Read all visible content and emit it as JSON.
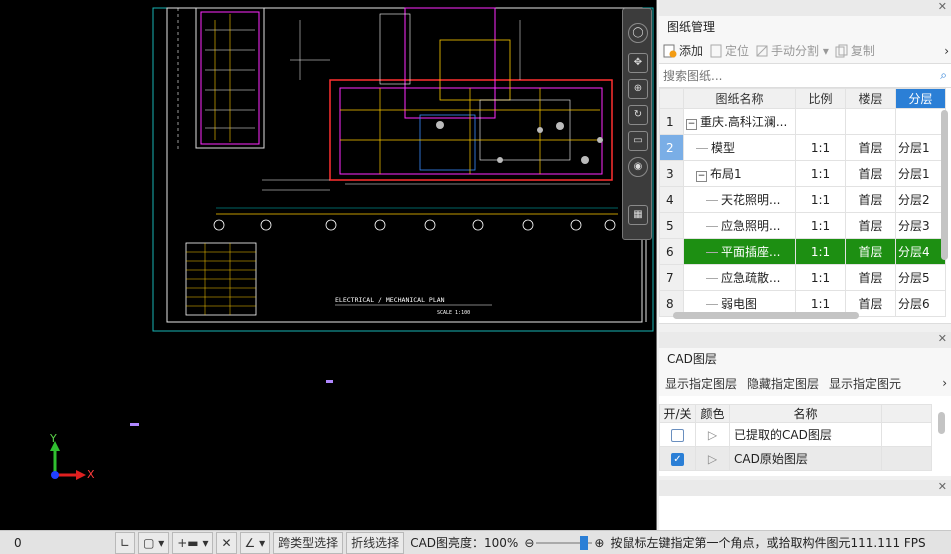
{
  "drawing_manager": {
    "title": "图纸管理",
    "toolbar": {
      "add": "添加",
      "locate": "定位",
      "manual_split": "手动分割",
      "copy": "复制"
    },
    "search_placeholder": "搜索图纸...",
    "columns": [
      "图纸名称",
      "比例",
      "楼层",
      "分层"
    ],
    "rows": [
      {
        "num": "1",
        "expander": "−",
        "name": "重庆.高科江澜...",
        "scale": "",
        "floor": "",
        "layer": ""
      },
      {
        "num": "2",
        "expander": "",
        "name": "模型",
        "scale": "1:1",
        "floor": "首层",
        "layer": "分层1"
      },
      {
        "num": "3",
        "expander": "−",
        "name": "布局1",
        "scale": "1:1",
        "floor": "首层",
        "layer": "分层1"
      },
      {
        "num": "4",
        "expander": "",
        "name": "天花照明...",
        "scale": "1:1",
        "floor": "首层",
        "layer": "分层2"
      },
      {
        "num": "5",
        "expander": "",
        "name": "应急照明...",
        "scale": "1:1",
        "floor": "首层",
        "layer": "分层3"
      },
      {
        "num": "6",
        "expander": "",
        "name": "平面插座...",
        "scale": "1:1",
        "floor": "首层",
        "layer": "分层4"
      },
      {
        "num": "7",
        "expander": "",
        "name": "应急疏散...",
        "scale": "1:1",
        "floor": "首层",
        "layer": "分层5"
      },
      {
        "num": "8",
        "expander": "",
        "name": "弱电图",
        "scale": "1:1",
        "floor": "首层",
        "layer": "分层6"
      }
    ]
  },
  "cad_layers": {
    "title": "CAD图层",
    "actions": {
      "show": "显示指定图层",
      "hide": "隐藏指定图层",
      "show_elem": "显示指定图元"
    },
    "columns": {
      "toggle": "开/关",
      "color": "颜色",
      "name": "名称"
    },
    "rows": [
      {
        "name": "已提取的CAD图层"
      },
      {
        "name": "CAD原始图层"
      }
    ]
  },
  "canvas": {
    "plan_title": "ELECTRICAL / MECHANICAL PLAN",
    "scale_label": "SCALE 1:100",
    "axis_x": "X",
    "axis_y": "Y"
  },
  "status_bar": {
    "coord": "0",
    "cross_type_select": "跨类型选择",
    "polyline_select": "折线选择",
    "brightness": "CAD图亮度：100%",
    "hint": "按鼠标左键指定第一个角点，或拾取构件图元",
    "fps": "111.111 FPS"
  },
  "colors": {
    "selected_row": "#1d8f12",
    "active_num": "#7aaee6",
    "canvas": "#000000",
    "accent": "#2b7fd6"
  }
}
